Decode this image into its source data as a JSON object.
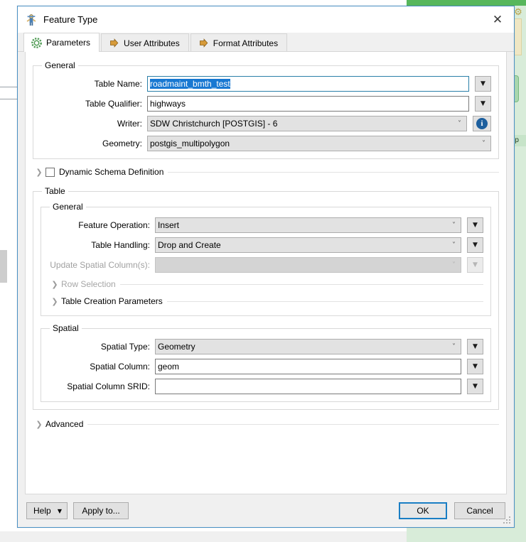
{
  "background": {
    "row_label": "Inp"
  },
  "dialog": {
    "title": "Feature Type",
    "title_icon": "feature-type-icon",
    "close_icon": "close-icon",
    "tabs": [
      {
        "label": "Parameters",
        "icon": "gear-icon",
        "active": true
      },
      {
        "label": "User Attributes",
        "icon": "arrow-right-icon",
        "active": false
      },
      {
        "label": "Format Attributes",
        "icon": "arrow-right-icon",
        "active": false
      }
    ],
    "general": {
      "legend": "General",
      "table_name": {
        "label": "Table Name:",
        "value": "roadmaint_bmth_test"
      },
      "table_qualifier": {
        "label": "Table Qualifier:",
        "value": "highways"
      },
      "writer": {
        "label": "Writer:",
        "value": "SDW Christchurch [POSTGIS] - 6"
      },
      "geometry": {
        "label": "Geometry:",
        "value": "postgis_multipolygon"
      },
      "dynamic_schema": {
        "label": "Dynamic Schema Definition",
        "checked": false
      }
    },
    "table": {
      "legend": "Table",
      "sub_legend": "General",
      "feature_operation": {
        "label": "Feature Operation:",
        "value": "Insert"
      },
      "table_handling": {
        "label": "Table Handling:",
        "value": "Drop and Create"
      },
      "update_spatial_columns": {
        "label": "Update Spatial Column(s):",
        "value": ""
      },
      "row_selection": {
        "label": "Row Selection"
      },
      "table_creation_parameters": {
        "label": "Table Creation Parameters"
      }
    },
    "spatial": {
      "legend": "Spatial",
      "spatial_type": {
        "label": "Spatial Type:",
        "value": "Geometry"
      },
      "spatial_column": {
        "label": "Spatial Column:",
        "value": "geom"
      },
      "spatial_column_srid": {
        "label": "Spatial Column SRID:",
        "value": ""
      }
    },
    "advanced": {
      "label": "Advanced"
    },
    "footer": {
      "help": "Help",
      "apply_to": "Apply to...",
      "ok": "OK",
      "cancel": "Cancel"
    }
  },
  "colors": {
    "accent": "#1a7ec4",
    "selection": "#1878d2",
    "info": "#1d5f9e",
    "dialog_border": "#4a90c4",
    "backdrop_green": "#d8ecd9"
  }
}
